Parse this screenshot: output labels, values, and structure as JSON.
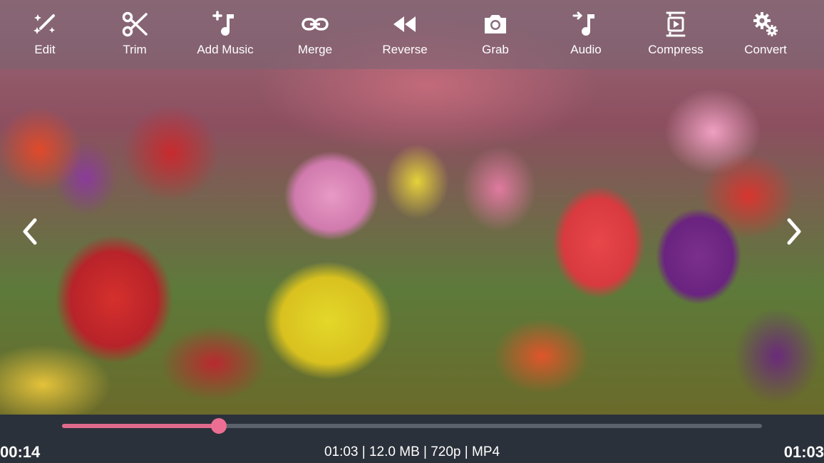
{
  "toolbar": {
    "items": [
      {
        "label": "Edit",
        "icon": "magic-wand-icon"
      },
      {
        "label": "Trim",
        "icon": "scissors-icon"
      },
      {
        "label": "Add Music",
        "icon": "add-music-icon"
      },
      {
        "label": "Merge",
        "icon": "link-icon"
      },
      {
        "label": "Reverse",
        "icon": "rewind-icon"
      },
      {
        "label": "Grab",
        "icon": "camera-icon"
      },
      {
        "label": "Audio",
        "icon": "audio-icon"
      },
      {
        "label": "Compress",
        "icon": "compress-video-icon"
      },
      {
        "label": "Convert",
        "icon": "gears-icon"
      }
    ]
  },
  "navigation": {
    "prev_icon": "chevron-left-icon",
    "next_icon": "chevron-right-icon"
  },
  "playback": {
    "current_time": "00:14",
    "total_time": "01:03",
    "progress": 0.224,
    "info": "01:03 | 12.0 MB | 720p | MP4"
  },
  "colors": {
    "progress_fill": "#e06a8c",
    "progress_track": "#5b626b",
    "bottom_bar": "#2b313a"
  }
}
